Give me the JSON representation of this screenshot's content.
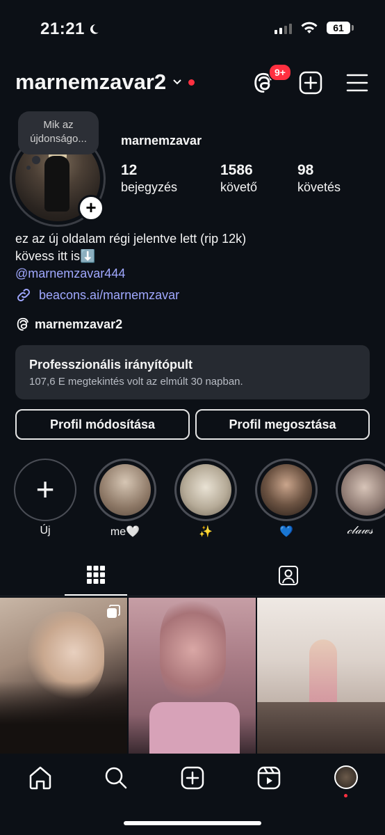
{
  "status": {
    "time": "21:21",
    "battery": "61"
  },
  "header": {
    "username": "marnemzavar2",
    "notif_badge": "9+"
  },
  "profile": {
    "note": "Mik az újdonságo...",
    "full_name": "marnemzavar",
    "posts_count": "12",
    "posts_label": "bejegyzés",
    "followers_count": "1586",
    "followers_label": "követő",
    "following_count": "98",
    "following_label": "követés",
    "bio_line1": "ez az új oldalam régi jelentve lett (rip 12k)",
    "bio_line2": "kövess itt is⬇️",
    "mention": "@marnemzavar444",
    "link": "beacons.ai/marnemzavar",
    "threads_handle": "marnemzavar2"
  },
  "dashboard": {
    "title": "Professzionális irányítópult",
    "subtitle": "107,6 E megtekintés volt az elmúlt 30 napban."
  },
  "buttons": {
    "edit": "Profil módosítása",
    "share": "Profil megosztása"
  },
  "highlights": [
    {
      "label": "Új"
    },
    {
      "label": "me🤍"
    },
    {
      "label": "✨"
    },
    {
      "label": "💙"
    },
    {
      "label": "𝒸𝓁𝒶𝓌𝓈"
    }
  ],
  "colors": {
    "background": "#0c1016",
    "accent_link": "#a0a8ff",
    "notification": "#ff3040"
  },
  "icons": [
    "moon-icon",
    "signal-icon",
    "wifi-icon",
    "threads-icon",
    "new-post-icon",
    "menu-icon",
    "link-icon",
    "grid-icon",
    "tagged-icon",
    "home-icon",
    "search-icon",
    "create-icon",
    "reels-icon"
  ]
}
